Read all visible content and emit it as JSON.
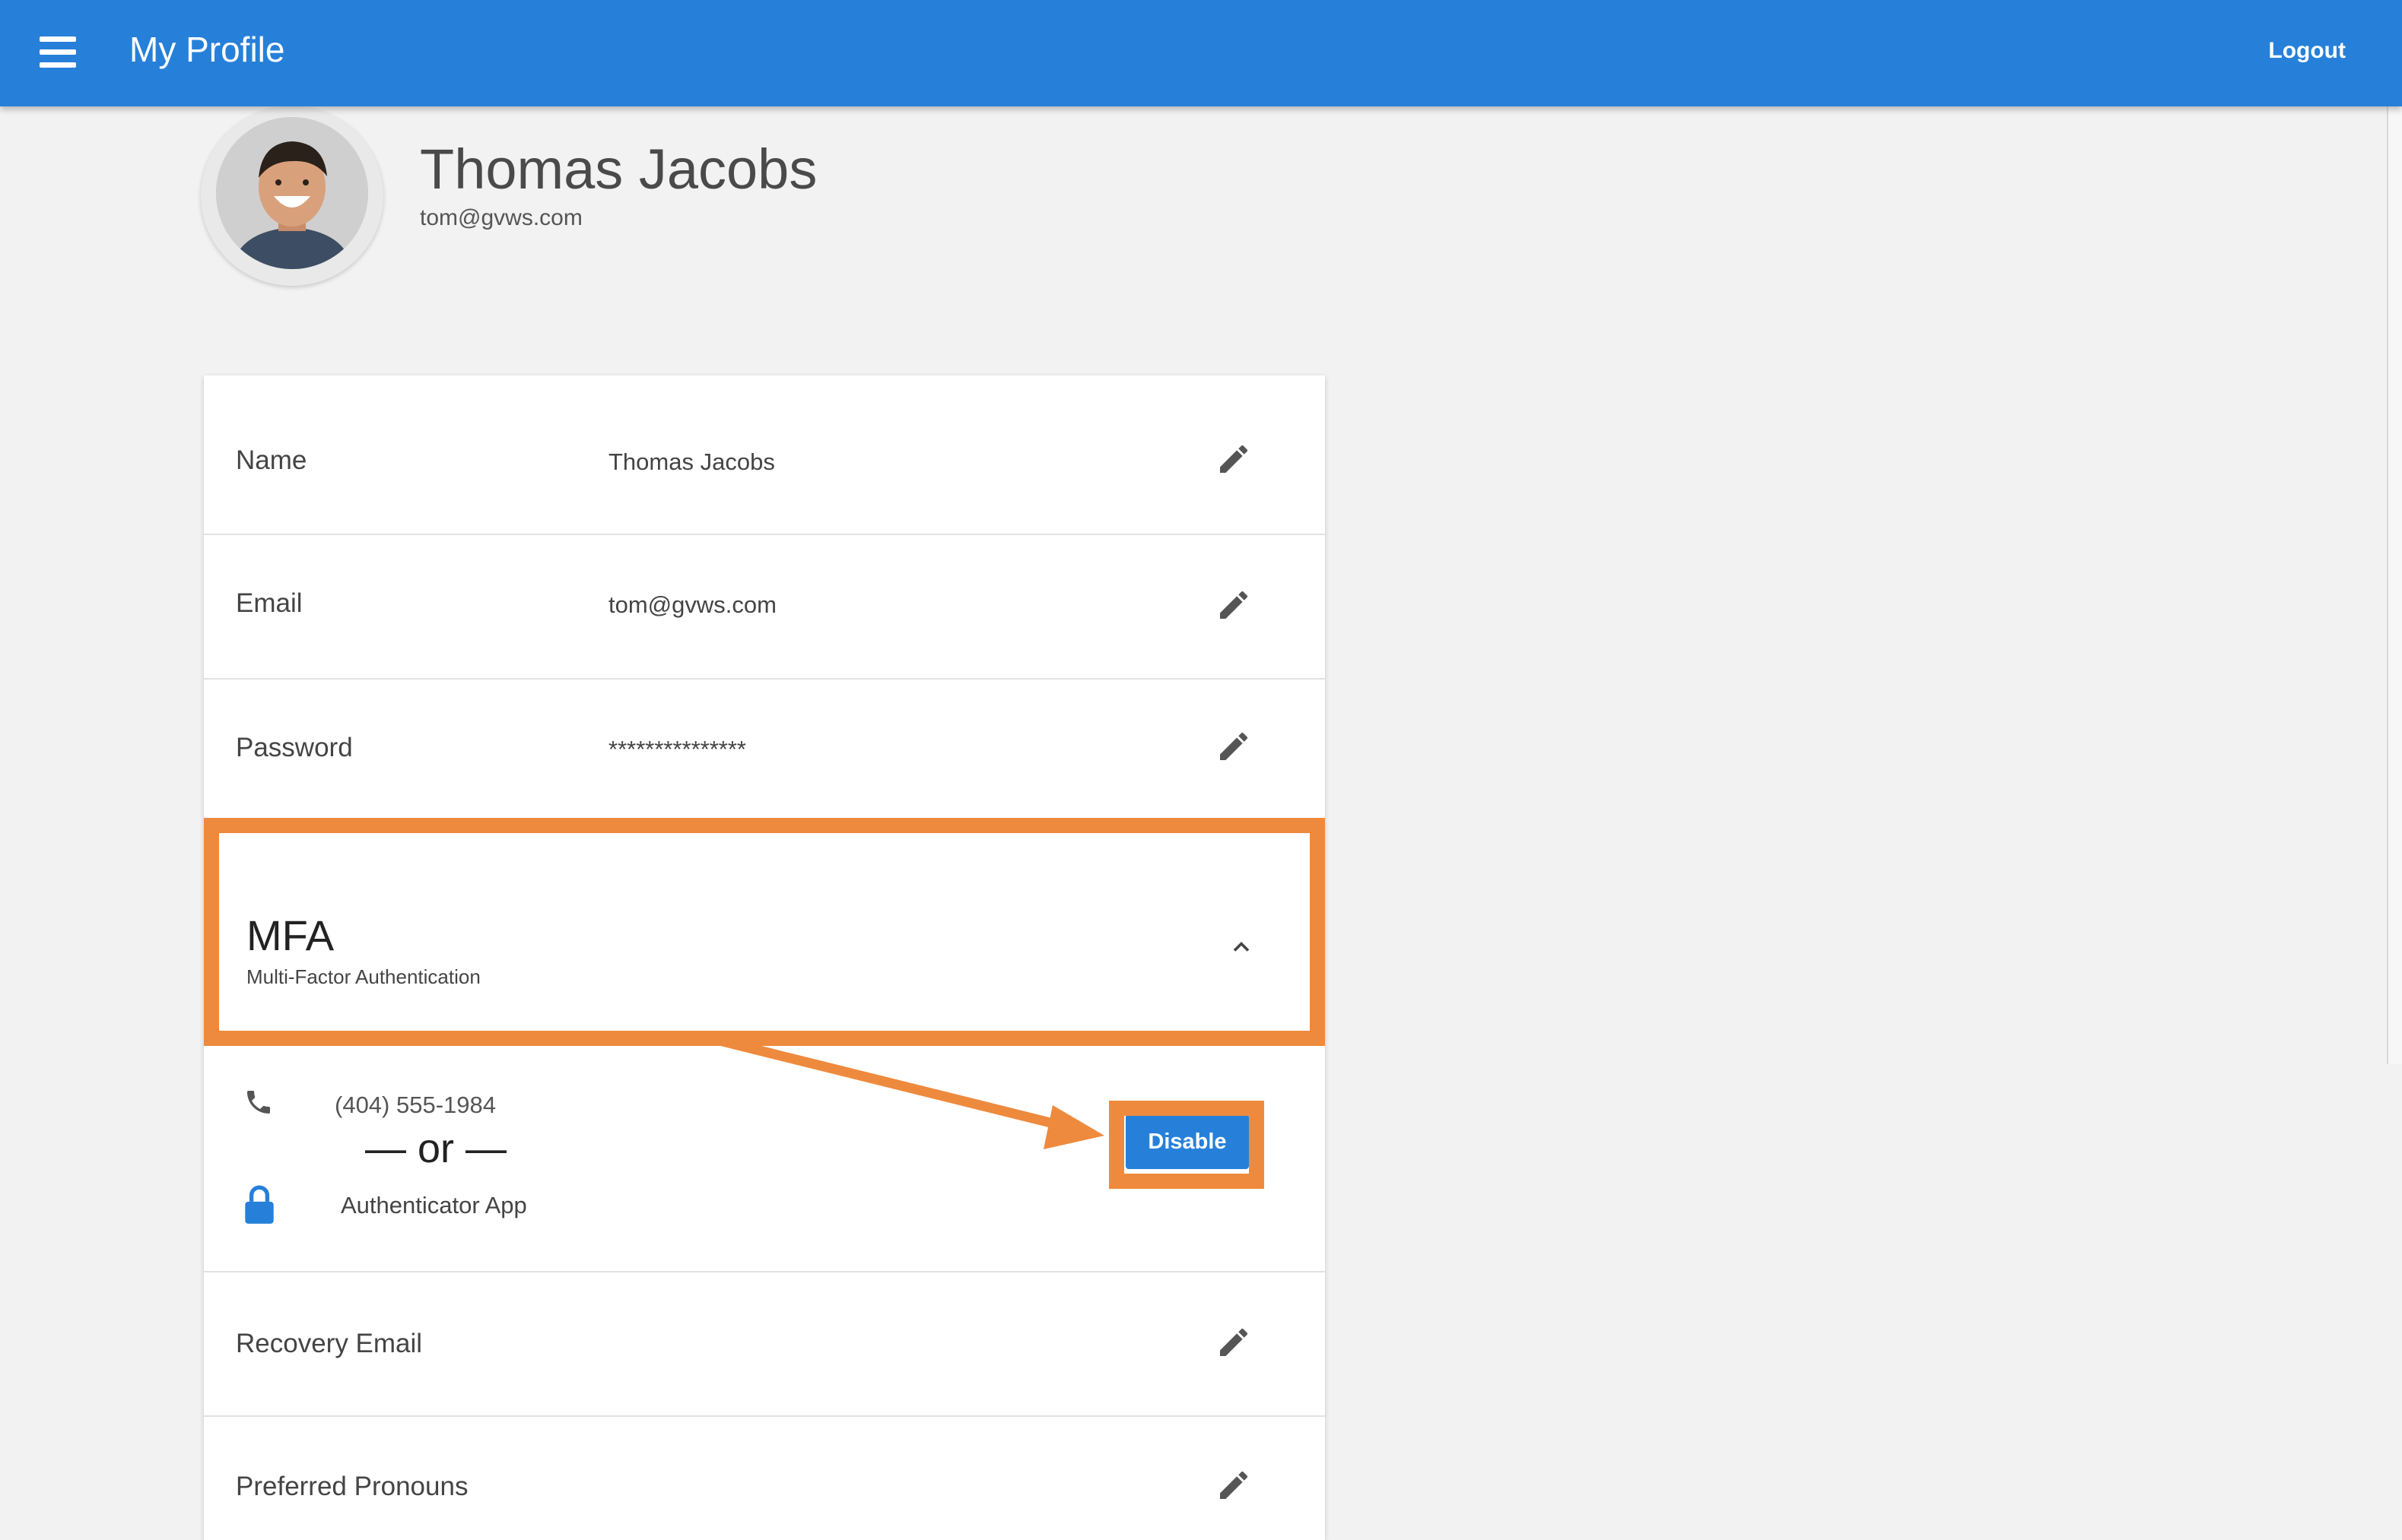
{
  "appbar": {
    "title": "My Profile",
    "logout_label": "Logout"
  },
  "profile": {
    "name": "Thomas Jacobs",
    "email": "tom@gvws.com"
  },
  "fields": {
    "name": {
      "label": "Name",
      "value": "Thomas Jacobs"
    },
    "email": {
      "label": "Email",
      "value": "tom@gvws.com"
    },
    "password": {
      "label": "Password",
      "value": "***************"
    },
    "recovery_email": {
      "label": "Recovery Email"
    },
    "pronouns": {
      "label": "Preferred Pronouns"
    }
  },
  "mfa": {
    "title": "MFA",
    "subtitle": "Multi-Factor Authentication",
    "phone": "(404) 555-1984",
    "or_text": "— or —",
    "authenticator": "Authenticator App",
    "disable_label": "Disable"
  },
  "colors": {
    "primary": "#2680d9",
    "highlight": "#ee8a3e",
    "background": "#f2f2f2"
  },
  "icons": [
    "menu-icon",
    "pencil-icon",
    "chevron-up-icon",
    "phone-icon",
    "lock-icon"
  ]
}
